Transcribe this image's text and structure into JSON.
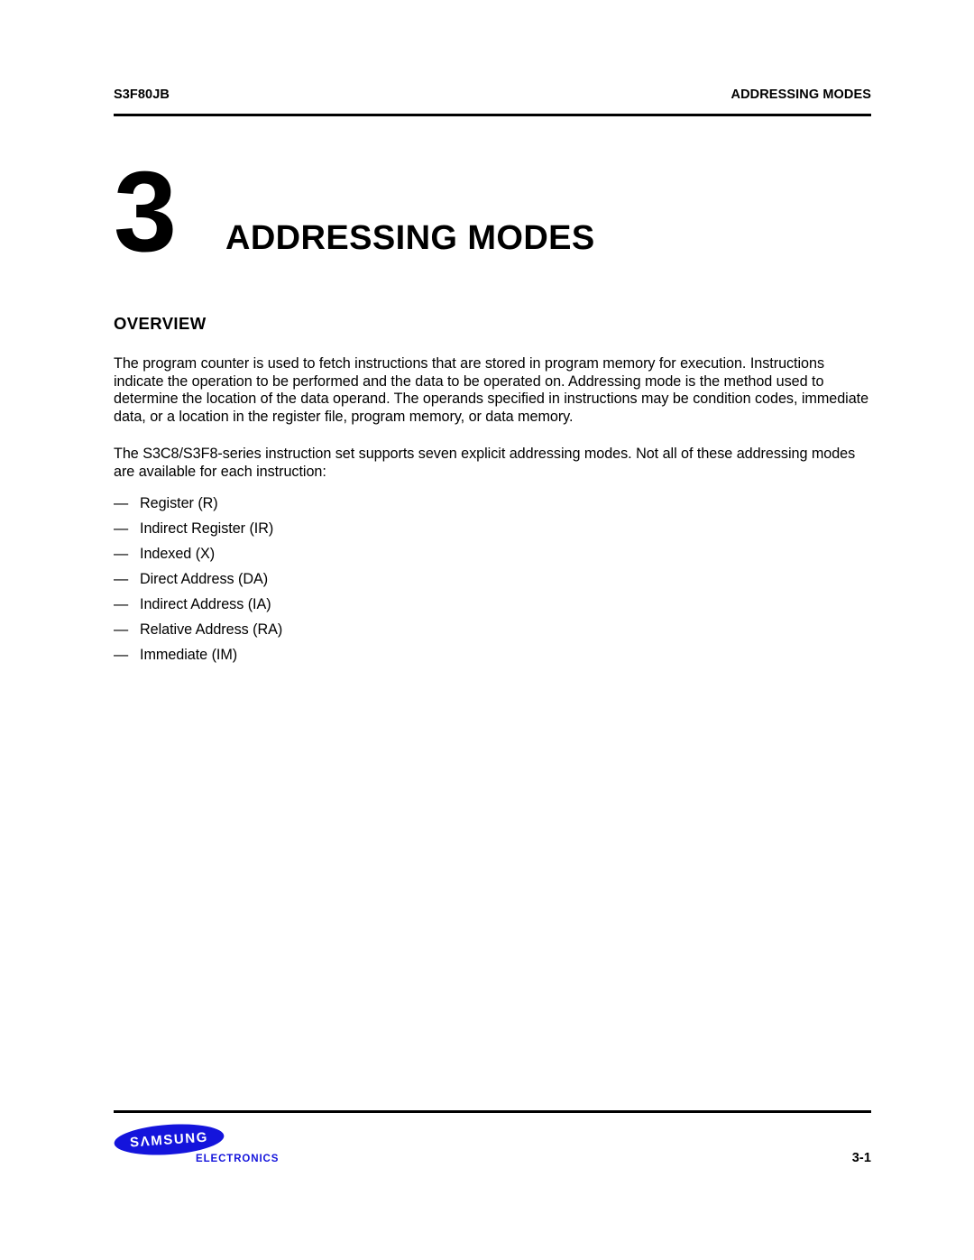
{
  "header": {
    "left": "S3F80JB",
    "right": "ADDRESSING MODES"
  },
  "chapter": {
    "number": "3",
    "title": "ADDRESSING MODES"
  },
  "section": {
    "heading": "OVERVIEW",
    "paragraphs": [
      "The program counter is used to fetch instructions that are stored in program memory for execution. Instructions indicate the operation to be performed and the data to be operated on. Addressing mode is the method used to determine the location of the data operand. The operands specified in instructions may be condition codes, immediate data, or a location in the register file, program memory, or data memory.",
      "The S3C8/S3F8-series instruction set supports seven explicit addressing modes. Not all of these addressing modes are available for each instruction:"
    ],
    "list_bullet": "—",
    "list_items": [
      "Register (R)",
      "Indirect Register (IR)",
      "Indexed (X)",
      "Direct Address (DA)",
      "Indirect Address (IA)",
      "Relative Address (RA)",
      "Immediate (IM)"
    ]
  },
  "footer": {
    "logo_text": "SAMSUNG",
    "logo_subtext": "ELECTRONICS",
    "logo_color": "#1414DC",
    "page_number": "3-1"
  }
}
